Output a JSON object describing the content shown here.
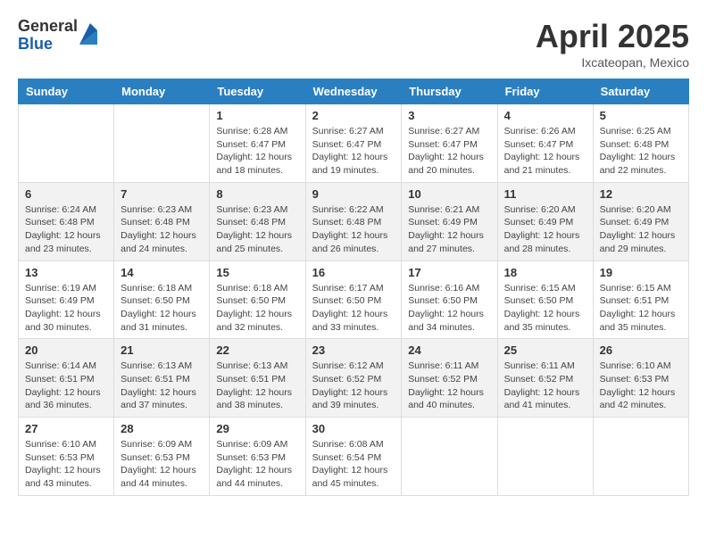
{
  "header": {
    "logo_general": "General",
    "logo_blue": "Blue",
    "month_title": "April 2025",
    "subtitle": "Ixcateopan, Mexico"
  },
  "calendar": {
    "days_of_week": [
      "Sunday",
      "Monday",
      "Tuesday",
      "Wednesday",
      "Thursday",
      "Friday",
      "Saturday"
    ],
    "weeks": [
      [
        {
          "day": "",
          "info": ""
        },
        {
          "day": "",
          "info": ""
        },
        {
          "day": "1",
          "info": "Sunrise: 6:28 AM\nSunset: 6:47 PM\nDaylight: 12 hours and 18 minutes."
        },
        {
          "day": "2",
          "info": "Sunrise: 6:27 AM\nSunset: 6:47 PM\nDaylight: 12 hours and 19 minutes."
        },
        {
          "day": "3",
          "info": "Sunrise: 6:27 AM\nSunset: 6:47 PM\nDaylight: 12 hours and 20 minutes."
        },
        {
          "day": "4",
          "info": "Sunrise: 6:26 AM\nSunset: 6:47 PM\nDaylight: 12 hours and 21 minutes."
        },
        {
          "day": "5",
          "info": "Sunrise: 6:25 AM\nSunset: 6:48 PM\nDaylight: 12 hours and 22 minutes."
        }
      ],
      [
        {
          "day": "6",
          "info": "Sunrise: 6:24 AM\nSunset: 6:48 PM\nDaylight: 12 hours and 23 minutes."
        },
        {
          "day": "7",
          "info": "Sunrise: 6:23 AM\nSunset: 6:48 PM\nDaylight: 12 hours and 24 minutes."
        },
        {
          "day": "8",
          "info": "Sunrise: 6:23 AM\nSunset: 6:48 PM\nDaylight: 12 hours and 25 minutes."
        },
        {
          "day": "9",
          "info": "Sunrise: 6:22 AM\nSunset: 6:48 PM\nDaylight: 12 hours and 26 minutes."
        },
        {
          "day": "10",
          "info": "Sunrise: 6:21 AM\nSunset: 6:49 PM\nDaylight: 12 hours and 27 minutes."
        },
        {
          "day": "11",
          "info": "Sunrise: 6:20 AM\nSunset: 6:49 PM\nDaylight: 12 hours and 28 minutes."
        },
        {
          "day": "12",
          "info": "Sunrise: 6:20 AM\nSunset: 6:49 PM\nDaylight: 12 hours and 29 minutes."
        }
      ],
      [
        {
          "day": "13",
          "info": "Sunrise: 6:19 AM\nSunset: 6:49 PM\nDaylight: 12 hours and 30 minutes."
        },
        {
          "day": "14",
          "info": "Sunrise: 6:18 AM\nSunset: 6:50 PM\nDaylight: 12 hours and 31 minutes."
        },
        {
          "day": "15",
          "info": "Sunrise: 6:18 AM\nSunset: 6:50 PM\nDaylight: 12 hours and 32 minutes."
        },
        {
          "day": "16",
          "info": "Sunrise: 6:17 AM\nSunset: 6:50 PM\nDaylight: 12 hours and 33 minutes."
        },
        {
          "day": "17",
          "info": "Sunrise: 6:16 AM\nSunset: 6:50 PM\nDaylight: 12 hours and 34 minutes."
        },
        {
          "day": "18",
          "info": "Sunrise: 6:15 AM\nSunset: 6:50 PM\nDaylight: 12 hours and 35 minutes."
        },
        {
          "day": "19",
          "info": "Sunrise: 6:15 AM\nSunset: 6:51 PM\nDaylight: 12 hours and 35 minutes."
        }
      ],
      [
        {
          "day": "20",
          "info": "Sunrise: 6:14 AM\nSunset: 6:51 PM\nDaylight: 12 hours and 36 minutes."
        },
        {
          "day": "21",
          "info": "Sunrise: 6:13 AM\nSunset: 6:51 PM\nDaylight: 12 hours and 37 minutes."
        },
        {
          "day": "22",
          "info": "Sunrise: 6:13 AM\nSunset: 6:51 PM\nDaylight: 12 hours and 38 minutes."
        },
        {
          "day": "23",
          "info": "Sunrise: 6:12 AM\nSunset: 6:52 PM\nDaylight: 12 hours and 39 minutes."
        },
        {
          "day": "24",
          "info": "Sunrise: 6:11 AM\nSunset: 6:52 PM\nDaylight: 12 hours and 40 minutes."
        },
        {
          "day": "25",
          "info": "Sunrise: 6:11 AM\nSunset: 6:52 PM\nDaylight: 12 hours and 41 minutes."
        },
        {
          "day": "26",
          "info": "Sunrise: 6:10 AM\nSunset: 6:53 PM\nDaylight: 12 hours and 42 minutes."
        }
      ],
      [
        {
          "day": "27",
          "info": "Sunrise: 6:10 AM\nSunset: 6:53 PM\nDaylight: 12 hours and 43 minutes."
        },
        {
          "day": "28",
          "info": "Sunrise: 6:09 AM\nSunset: 6:53 PM\nDaylight: 12 hours and 44 minutes."
        },
        {
          "day": "29",
          "info": "Sunrise: 6:09 AM\nSunset: 6:53 PM\nDaylight: 12 hours and 44 minutes."
        },
        {
          "day": "30",
          "info": "Sunrise: 6:08 AM\nSunset: 6:54 PM\nDaylight: 12 hours and 45 minutes."
        },
        {
          "day": "",
          "info": ""
        },
        {
          "day": "",
          "info": ""
        },
        {
          "day": "",
          "info": ""
        }
      ]
    ]
  }
}
